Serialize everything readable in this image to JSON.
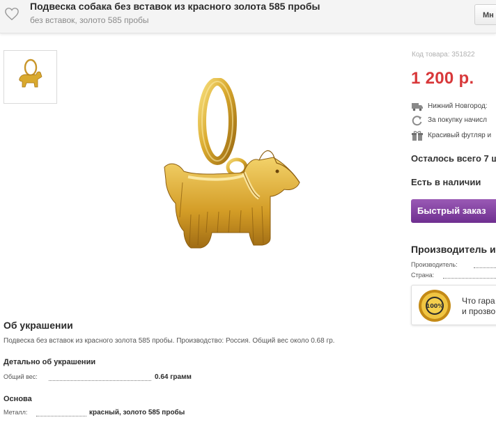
{
  "header": {
    "title": "Подвеска собака без вставок из красного золота 585 пробы",
    "subtitle": "без вставок, золото 585 пробы",
    "button_label": "Мн",
    "favorite_icon": "heart-outline-icon"
  },
  "product": {
    "code": "Код товара: 351822",
    "price": "1 200 р.",
    "info": [
      {
        "icon": "truck-icon",
        "text": "Нижний Новгород:"
      },
      {
        "icon": "refresh-icon",
        "text": "За покупку начисл"
      },
      {
        "icon": "gift-icon",
        "text": "Красивый футляр и"
      }
    ],
    "remaining": "Осталось всего 7 ш",
    "availability": "Есть в наличии",
    "order_button": "Быстрый заказ"
  },
  "manufacturer": {
    "title": "Производитель и",
    "rows": [
      {
        "label": "Производитель:"
      },
      {
        "label": "Страна:"
      }
    ]
  },
  "guarantee": {
    "seal_text": "100%",
    "line1": "Что гара",
    "line2": "и прозво"
  },
  "about": {
    "title": "Об украшении",
    "description": "Подвеска без вставок из красного золота 585 пробы. Производство: Россия. Общий вес около 0.68 гр."
  },
  "details": {
    "title": "Детально об украшении",
    "weight_label": "Общий вес:",
    "weight_value": "0.64 грамм"
  },
  "basis": {
    "title": "Основа",
    "metal_label": "Металл:",
    "metal_value": "красный, золото 585 пробы"
  },
  "colors": {
    "price": "#d8383a",
    "order_button": "#7d3a9c",
    "gold": "#d9a92e"
  }
}
